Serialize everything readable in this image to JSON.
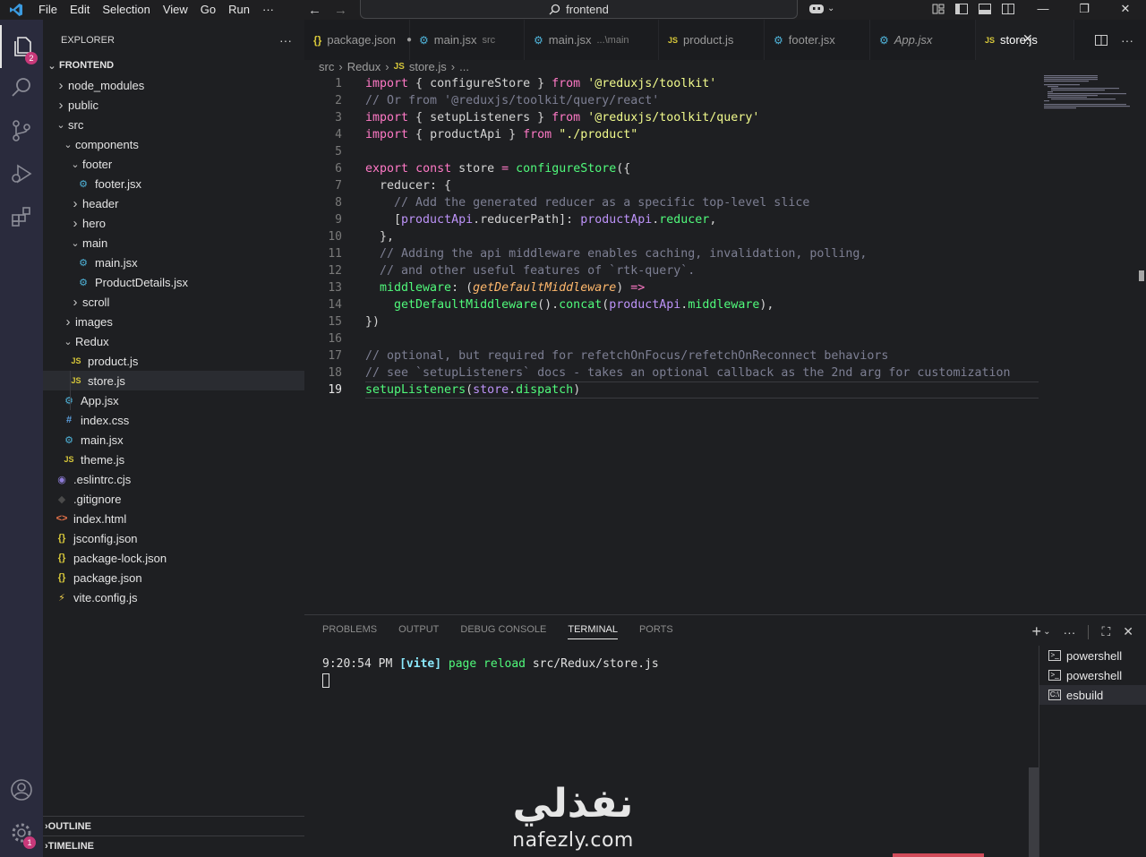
{
  "menu": [
    "File",
    "Edit",
    "Selection",
    "View",
    "Go",
    "Run",
    "···"
  ],
  "command_center": {
    "label": "frontend"
  },
  "activity": {
    "explorer_badge": "2",
    "settings_badge": "1"
  },
  "explorer": {
    "title": "EXPLORER",
    "more": "···",
    "root": "FRONTEND",
    "items": [
      {
        "label": "node_modules",
        "type": "folder",
        "open": false,
        "depth": 0
      },
      {
        "label": "public",
        "type": "folder",
        "open": false,
        "depth": 0
      },
      {
        "label": "src",
        "type": "folder",
        "open": true,
        "depth": 0
      },
      {
        "label": "components",
        "type": "folder",
        "open": true,
        "depth": 1
      },
      {
        "label": "footer",
        "type": "folder",
        "open": true,
        "depth": 2
      },
      {
        "label": "footer.jsx",
        "type": "jsx",
        "depth": 3
      },
      {
        "label": "header",
        "type": "folder",
        "open": false,
        "depth": 2
      },
      {
        "label": "hero",
        "type": "folder",
        "open": false,
        "depth": 2
      },
      {
        "label": "main",
        "type": "folder",
        "open": true,
        "depth": 2
      },
      {
        "label": "main.jsx",
        "type": "jsx",
        "depth": 3
      },
      {
        "label": "ProductDetails.jsx",
        "type": "jsx",
        "depth": 3
      },
      {
        "label": "scroll",
        "type": "folder",
        "open": false,
        "depth": 2
      },
      {
        "label": "images",
        "type": "folder",
        "open": false,
        "depth": 1
      },
      {
        "label": "Redux",
        "type": "folder",
        "open": true,
        "depth": 1
      },
      {
        "label": "product.js",
        "type": "js",
        "depth": 2
      },
      {
        "label": "store.js",
        "type": "js",
        "depth": 2,
        "selected": true
      },
      {
        "label": "App.jsx",
        "type": "jsx",
        "depth": 1
      },
      {
        "label": "index.css",
        "type": "css",
        "depth": 1
      },
      {
        "label": "main.jsx",
        "type": "jsx",
        "depth": 1
      },
      {
        "label": "theme.js",
        "type": "js",
        "depth": 1
      },
      {
        "label": ".eslintrc.cjs",
        "type": "eslint",
        "depth": 0
      },
      {
        "label": ".gitignore",
        "type": "git",
        "depth": 0
      },
      {
        "label": "index.html",
        "type": "html",
        "depth": 0
      },
      {
        "label": "jsconfig.json",
        "type": "json",
        "depth": 0
      },
      {
        "label": "package-lock.json",
        "type": "json",
        "depth": 0
      },
      {
        "label": "package.json",
        "type": "json",
        "depth": 0
      },
      {
        "label": "vite.config.js",
        "type": "vite",
        "depth": 0
      }
    ],
    "outline": "OUTLINE",
    "timeline": "TIMELINE"
  },
  "icons": {
    "jsx": "⚙",
    "js": "JS",
    "css": "#",
    "json": "{}",
    "html": "<>",
    "eslint": "◉",
    "git": "◆",
    "vite": "⚡"
  },
  "colors": {
    "jsx": "#4fb3d9",
    "js": "#d7c73a",
    "css": "#5ca0e0",
    "json": "#d7c73a",
    "html": "#e8734a",
    "eslint": "#8e7cd8",
    "git": "#4a4a4a",
    "vite": "#f2d14c"
  },
  "tabs": [
    {
      "icon": "{}",
      "label": "package.json",
      "sub": "",
      "modified": true
    },
    {
      "icon": "⚙",
      "label": "main.jsx",
      "sub": "src"
    },
    {
      "icon": "⚙",
      "label": "main.jsx",
      "sub": "...\\main"
    },
    {
      "icon": "JS",
      "label": "product.js",
      "sub": ""
    },
    {
      "icon": "⚙",
      "label": "footer.jsx",
      "sub": ""
    },
    {
      "icon": "⚙",
      "label": "App.jsx",
      "sub": "",
      "italic": true
    },
    {
      "icon": "JS",
      "label": "store.js",
      "sub": "",
      "active": true
    }
  ],
  "breadcrumb": [
    "src",
    "Redux",
    "JS",
    "store.js",
    "..."
  ],
  "code": {
    "current_line": 19,
    "lines": [
      [
        [
          "k",
          "import"
        ],
        [
          "pl",
          " { configureStore } "
        ],
        [
          "k",
          "from"
        ],
        [
          "pl",
          " "
        ],
        [
          "s",
          "'@reduxjs/toolkit'"
        ]
      ],
      [
        [
          "c",
          "// Or from '@reduxjs/toolkit/query/react'"
        ]
      ],
      [
        [
          "k",
          "import"
        ],
        [
          "pl",
          " { setupListeners } "
        ],
        [
          "k",
          "from"
        ],
        [
          "pl",
          " "
        ],
        [
          "s",
          "'@reduxjs/toolkit/query'"
        ]
      ],
      [
        [
          "k",
          "import"
        ],
        [
          "pl",
          " { productApi } "
        ],
        [
          "k",
          "from"
        ],
        [
          "pl",
          " "
        ],
        [
          "s",
          "\"./product\""
        ]
      ],
      [],
      [
        [
          "k",
          "export"
        ],
        [
          "pl",
          " "
        ],
        [
          "k",
          "const"
        ],
        [
          "pl",
          " store "
        ],
        [
          "k",
          "="
        ],
        [
          "pl",
          " "
        ],
        [
          "f",
          "configureStore"
        ],
        [
          "pl",
          "({"
        ]
      ],
      [
        [
          "pl",
          "  reducer: {"
        ]
      ],
      [
        [
          "c",
          "    // Add the generated reducer as a specific top-level slice"
        ]
      ],
      [
        [
          "pl",
          "    ["
        ],
        [
          "v",
          "productApi"
        ],
        [
          "pl",
          ".reducerPath]: "
        ],
        [
          "v",
          "productApi"
        ],
        [
          "pl",
          "."
        ],
        [
          "f",
          "reducer"
        ],
        [
          "pl",
          ","
        ]
      ],
      [
        [
          "pl",
          "  },"
        ]
      ],
      [
        [
          "c",
          "  // Adding the api middleware enables caching, invalidation, polling,"
        ]
      ],
      [
        [
          "c",
          "  // and other useful features of `rtk-query`."
        ]
      ],
      [
        [
          "f",
          "  middleware"
        ],
        [
          "pl",
          ": ("
        ],
        [
          "pi",
          "getDefaultMiddleware"
        ],
        [
          "pl",
          ") "
        ],
        [
          "k",
          "=>"
        ]
      ],
      [
        [
          "pl",
          "    "
        ],
        [
          "f",
          "getDefaultMiddleware"
        ],
        [
          "pl",
          "()."
        ],
        [
          "f",
          "concat"
        ],
        [
          "pl",
          "("
        ],
        [
          "v",
          "productApi"
        ],
        [
          "pl",
          "."
        ],
        [
          "f",
          "middleware"
        ],
        [
          "pl",
          "),"
        ]
      ],
      [
        [
          "pl",
          "})"
        ]
      ],
      [],
      [
        [
          "c",
          "// optional, but required for refetchOnFocus/refetchOnReconnect behaviors"
        ]
      ],
      [
        [
          "c",
          "// see `setupListeners` docs - takes an optional callback as the 2nd arg for customization"
        ]
      ],
      [
        [
          "f",
          "setupListeners"
        ],
        [
          "pl",
          "("
        ],
        [
          "v",
          "store"
        ],
        [
          "pl",
          "."
        ],
        [
          "f",
          "dispatch"
        ],
        [
          "pl",
          ")"
        ]
      ]
    ]
  },
  "panel": {
    "tabs": [
      "PROBLEMS",
      "OUTPUT",
      "DEBUG CONSOLE",
      "TERMINAL",
      "PORTS"
    ],
    "active_tab": "TERMINAL",
    "terminal_time": "9:20:54 PM",
    "terminal_tag": "[vite]",
    "terminal_msg": "page reload",
    "terminal_path": "src/Redux/store.js",
    "terminals": [
      "powershell",
      "powershell",
      "esbuild"
    ]
  },
  "watermark": {
    "arabic": "نفذلي",
    "latin": "nafezly.com"
  }
}
